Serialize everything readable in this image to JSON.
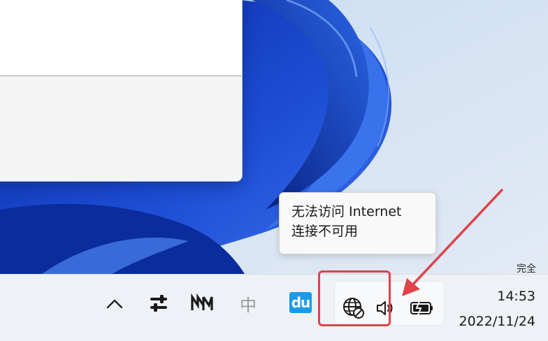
{
  "tooltip": {
    "line1": "无法访问 Internet",
    "line2": "连接不可用"
  },
  "corner_text": "完全",
  "taskbar": {
    "ime_label": "中",
    "du_label": "du",
    "time": "14:53",
    "date": "2022/11/24"
  },
  "icons": {
    "chevron": "chevron-up-icon",
    "settings": "settings-sliders-icon",
    "mm": "mm-logo-icon",
    "du": "baidu-du-icon",
    "network": "globe-no-network-icon",
    "volume": "speaker-icon",
    "battery": "battery-icon"
  },
  "colors": {
    "annotation": "#e0434a",
    "wallpaper_blue": "#1f4fd6",
    "taskbar_bg": "#eef1f6"
  }
}
